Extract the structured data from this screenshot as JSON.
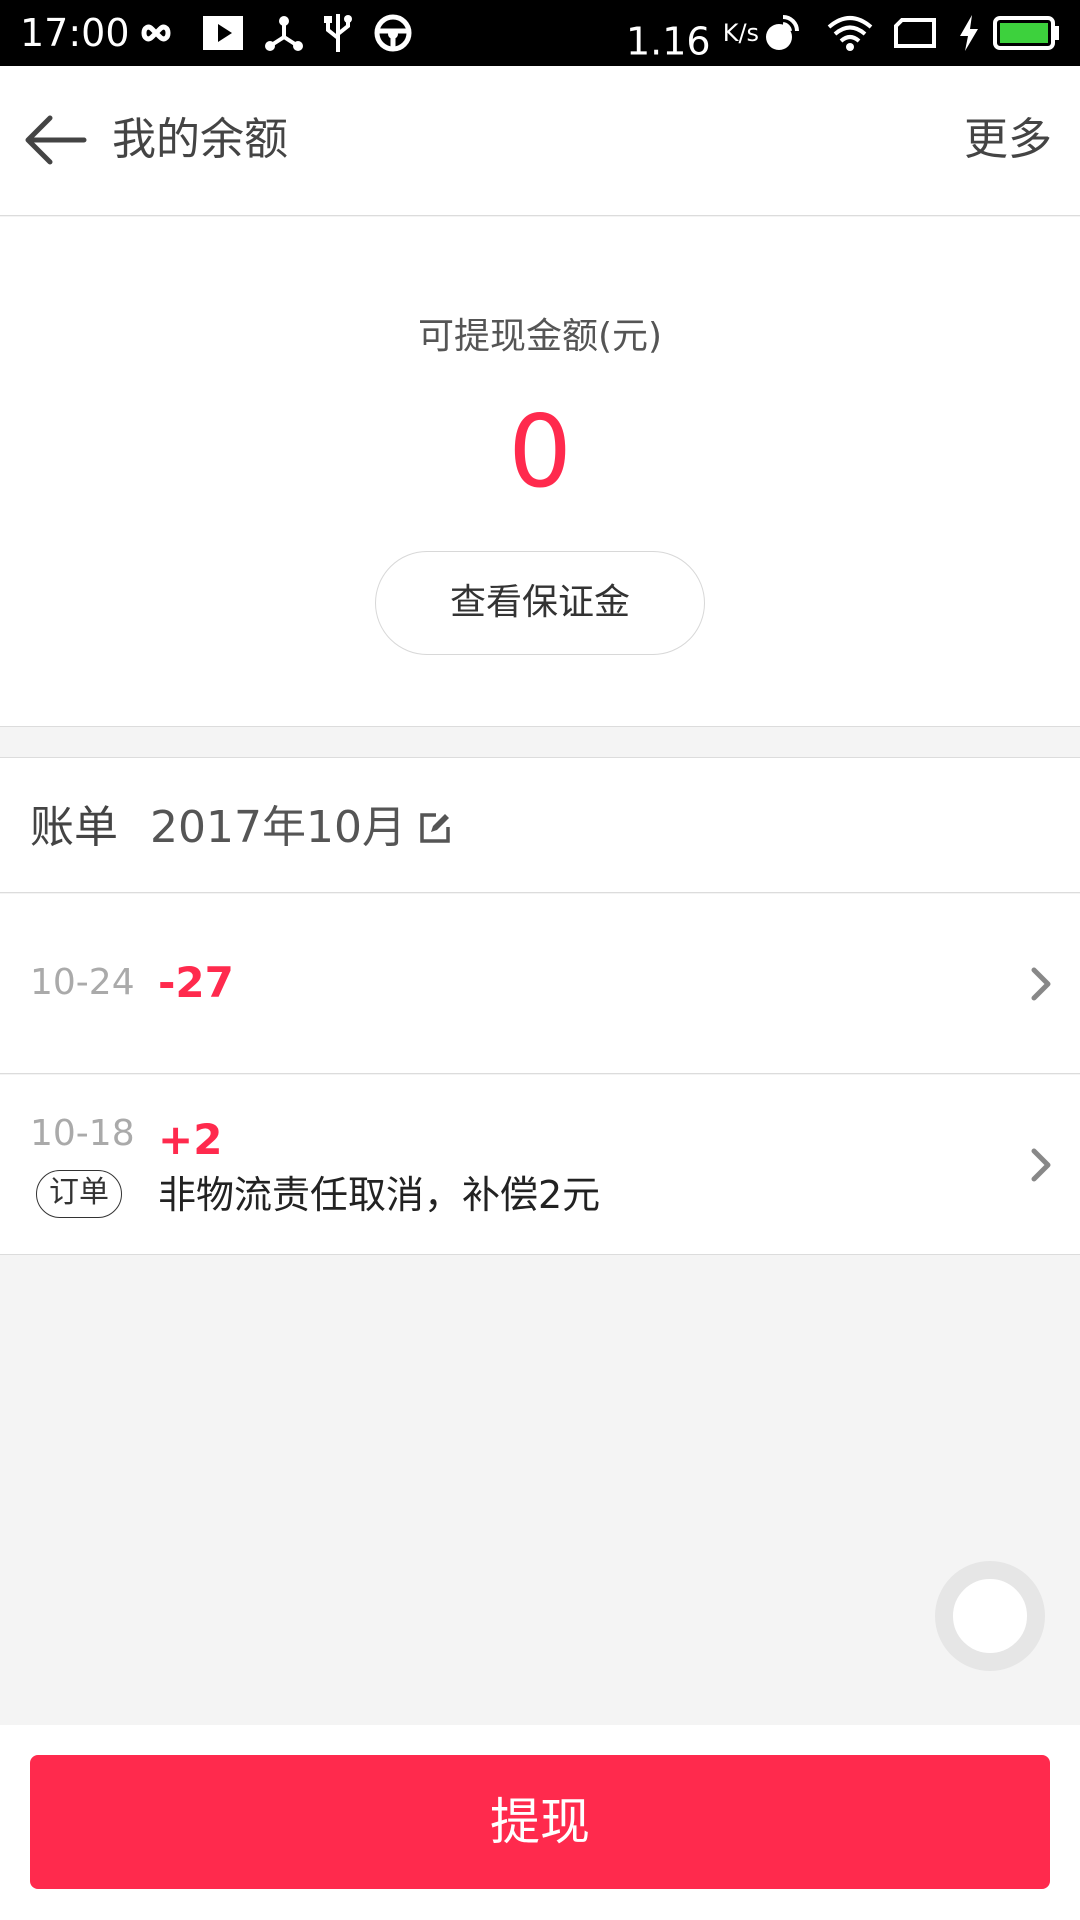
{
  "status_bar": {
    "time": "17:00",
    "speed_value": "1.16",
    "speed_unit": "K/s",
    "icons": [
      "infinity-icon",
      "play-icon",
      "share-icon",
      "usb-icon",
      "steering-icon",
      "data-saver-icon",
      "wifi-icon",
      "screen-icon",
      "charging-icon",
      "battery-icon"
    ],
    "battery_level": 1.0
  },
  "app_bar": {
    "title": "我的余额",
    "more": "更多"
  },
  "balance": {
    "label": "可提现金额(元)",
    "amount": "0",
    "deposit_button": "查看保证金"
  },
  "bill": {
    "label": "账单",
    "month": "2017年10月"
  },
  "transactions": [
    {
      "date": "10-24",
      "amount": "-27"
    },
    {
      "date": "10-18",
      "amount": "+2",
      "tag": "订单",
      "description": "非物流责任取消，补偿2元"
    }
  ],
  "withdraw_button": "提现",
  "colors": {
    "accent": "#ff2a4d",
    "background": "#f4f4f4"
  }
}
